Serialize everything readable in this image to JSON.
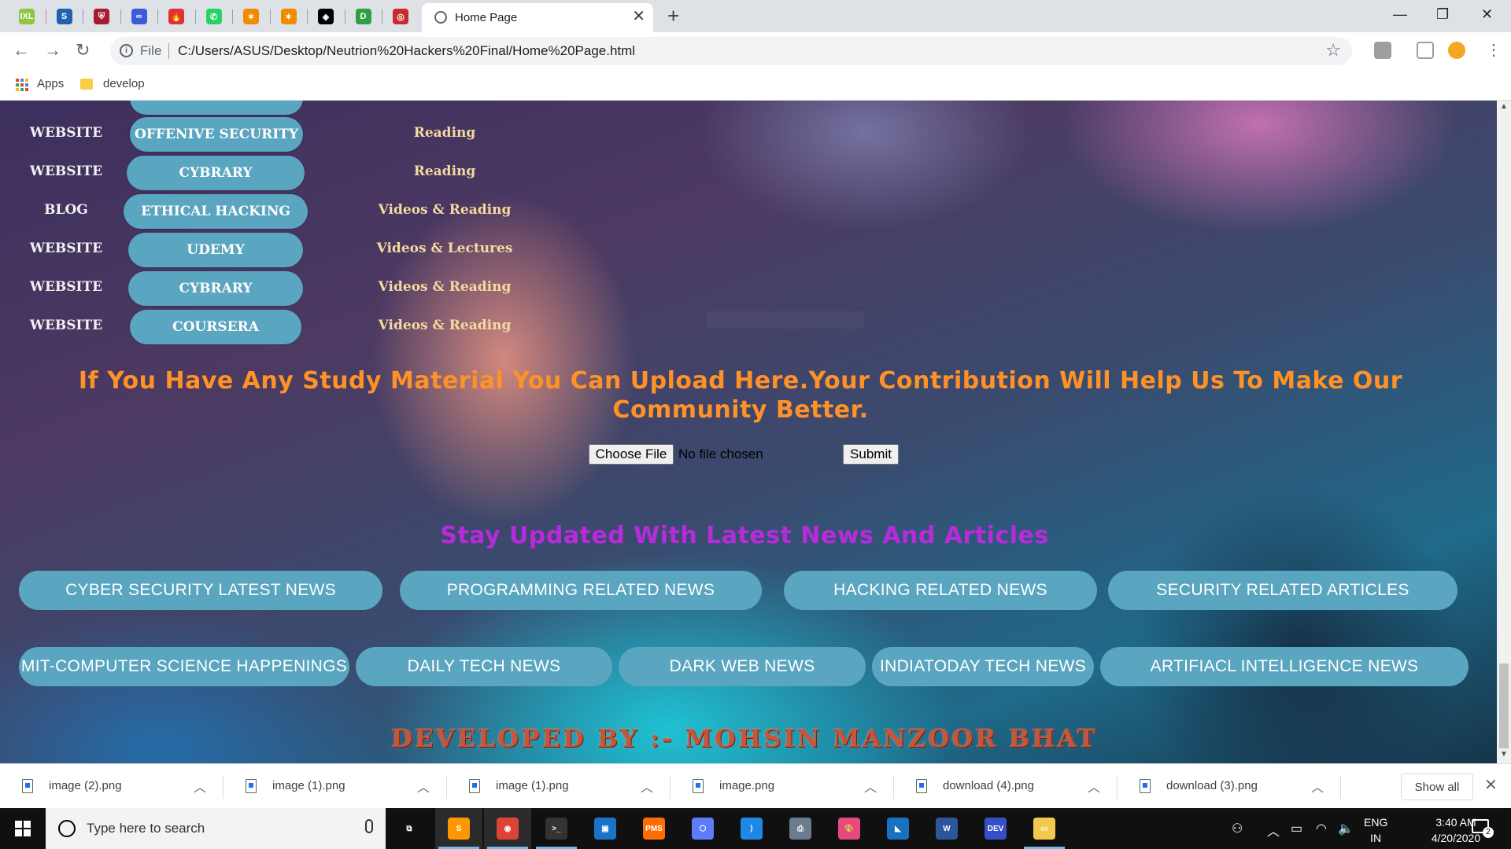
{
  "browser": {
    "pinned_tabs": [
      {
        "icon": "ixl-icon",
        "color": "#8dc63f",
        "glyph": "IXL"
      },
      {
        "icon": "s-circle-icon",
        "color": "#1e62b0",
        "glyph": "S"
      },
      {
        "icon": "shield-crest-icon",
        "color": "#a51c30",
        "glyph": "⛨"
      },
      {
        "icon": "infinity-icon",
        "color": "#3b5bdb",
        "glyph": "∞"
      },
      {
        "icon": "flame-icon",
        "color": "#e03131",
        "glyph": "🔥"
      },
      {
        "icon": "whatsapp-icon",
        "color": "#25d366",
        "glyph": "✆"
      },
      {
        "icon": "hackerrank-star-icon",
        "color": "#f08c00",
        "glyph": "✶"
      },
      {
        "icon": "hackerrank-star-icon",
        "color": "#f08c00",
        "glyph": "✶"
      },
      {
        "icon": "codepen-icon",
        "color": "#000000",
        "glyph": "◈"
      },
      {
        "icon": "d-square-icon",
        "color": "#2f9e44",
        "glyph": "D"
      },
      {
        "icon": "target-icon",
        "color": "#c92a2a",
        "glyph": "◎"
      }
    ],
    "active_tab_title": "Home Page",
    "url_scheme": "File",
    "url": "C:/Users/ASUS/Desktop/Neutrion%20Hackers%20Final/Home%20Page.html",
    "bookmarks": {
      "apps": "Apps",
      "folder": "develop"
    }
  },
  "table_rows": [
    {
      "type": "WEBSITE",
      "resource": "OFFENIVE SECURITY",
      "format": "Reading"
    },
    {
      "type": "WEBSITE",
      "resource": "CYBRARY",
      "format": "Reading"
    },
    {
      "type": "BLOG",
      "resource": "ETHICAL HACKING",
      "format": "Videos & Reading"
    },
    {
      "type": "WEBSITE",
      "resource": "UDEMY",
      "format": "Videos & Lectures"
    },
    {
      "type": "WEBSITE",
      "resource": "CYBRARY",
      "format": "Videos & Reading"
    },
    {
      "type": "WEBSITE",
      "resource": "COURSERA",
      "format": "Videos & Reading"
    }
  ],
  "upload": {
    "message": "If You Have Any Study Material You Can Upload Here.Your Contribution Will Help Us To Make Our Community Better.",
    "choose_file_label": "Choose File",
    "file_status": "No file chosen",
    "submit_label": "Submit"
  },
  "news": {
    "heading": "Stay Updated With Latest News And Articles",
    "row1": [
      "CYBER SECURITY LATEST NEWS",
      "PROGRAMMING RELATED NEWS",
      "HACKING RELATED NEWS",
      "SECURITY RELATED ARTICLES"
    ],
    "row2": [
      "MIT-COMPUTER SCIENCE HAPPENINGS",
      "DAILY TECH NEWS",
      "DARK WEB NEWS",
      "INDIATODAY TECH NEWS",
      "ARTIFIACL INTELLIGENCE NEWS"
    ]
  },
  "footer": {
    "credit": "DEVELOPED BY :- MOHSIN MANZOOR BHAT"
  },
  "downloads": {
    "items": [
      "image (2).png",
      "image (1).png",
      "image (1).png",
      "image.png",
      "download (4).png",
      "download (3).png"
    ],
    "show_all": "Show all"
  },
  "taskbar": {
    "search_placeholder": "Type here to search",
    "apps": [
      {
        "icon": "task-view-icon",
        "color": "#101010",
        "glyph": "⧉"
      },
      {
        "icon": "sublime-text-icon",
        "color": "#ff9800",
        "glyph": "S"
      },
      {
        "icon": "chrome-icon",
        "color": "#db4437",
        "glyph": "◉"
      },
      {
        "icon": "terminal-icon",
        "color": "#333333",
        "glyph": ">_"
      },
      {
        "icon": "virtualbox-icon",
        "color": "#1a73c8",
        "glyph": "▣"
      },
      {
        "icon": "pms-icon",
        "color": "#ff6d00",
        "glyph": "PMS"
      },
      {
        "icon": "box-3d-icon",
        "color": "#5c7cfa",
        "glyph": "⬡"
      },
      {
        "icon": "vscode-icon",
        "color": "#1e88e5",
        "glyph": "⟩"
      },
      {
        "icon": "printer-icon",
        "color": "#6b7c8f",
        "glyph": "⎙"
      },
      {
        "icon": "paint-icon",
        "color": "#e64980",
        "glyph": "🎨"
      },
      {
        "icon": "shark-fin-icon",
        "color": "#1971c2",
        "glyph": "◣"
      },
      {
        "icon": "word-icon",
        "color": "#2b579a",
        "glyph": "W"
      },
      {
        "icon": "dev-cpp-icon",
        "color": "#364fc7",
        "glyph": "DEV"
      },
      {
        "icon": "file-explorer-icon",
        "color": "#f2c94c",
        "glyph": "▭"
      }
    ],
    "lang_line1": "ENG",
    "lang_line2": "IN",
    "time": "3:40 AM",
    "date": "4/20/2020",
    "notification_count": "2"
  }
}
